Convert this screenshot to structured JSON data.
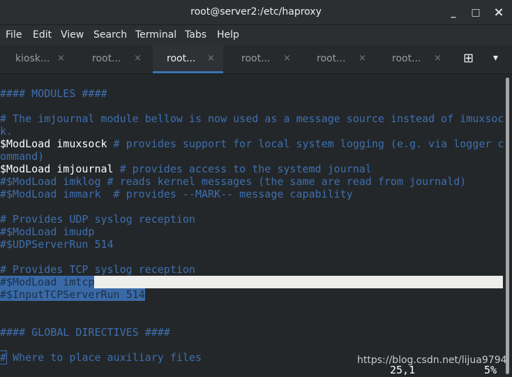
{
  "window": {
    "title": "root@server2:/etc/haproxy",
    "minimize": "_",
    "maximize": "□",
    "close": "×"
  },
  "menu": [
    "File",
    "Edit",
    "View",
    "Search",
    "Terminal",
    "Tabs",
    "Help"
  ],
  "tabs": [
    {
      "label": "kiosk..."
    },
    {
      "label": "root..."
    },
    {
      "label": "root...",
      "active": true
    },
    {
      "label": "root..."
    },
    {
      "label": "root..."
    },
    {
      "label": "root..."
    }
  ],
  "tab_close": "×",
  "new_tab_icon": "⊞",
  "tab_menu_icon": "▾",
  "lines": [
    "",
    "#### MODULES ####",
    "",
    "# The imjournal module bellow is now used as a message source instead of imuxsoc",
    "k.",
    "$ModLoad imuxsock",
    " # provides support for local system logging (e.g. via logger c",
    "ommand)",
    "$ModLoad imjournal",
    " # provides access to the systemd journal",
    "#$ModLoad imklog # reads kernel messages (the same are read from journald)",
    "#$ModLoad immark  # provides --MARK-- message capability",
    "# Provides UDP syslog reception",
    "#$ModLoad imudp",
    "#$UDPServerRun 514",
    "# Provides TCP syslog reception",
    "#$ModLoad imtcp",
    "#$InputTCPServerRun 514",
    "#### GLOBAL DIRECTIVES ####",
    "#",
    " Where to place auxiliary files"
  ],
  "status": {
    "position": "25,1",
    "percent": "5%"
  },
  "watermark": "https://blog.csdn.net/lijua9794"
}
